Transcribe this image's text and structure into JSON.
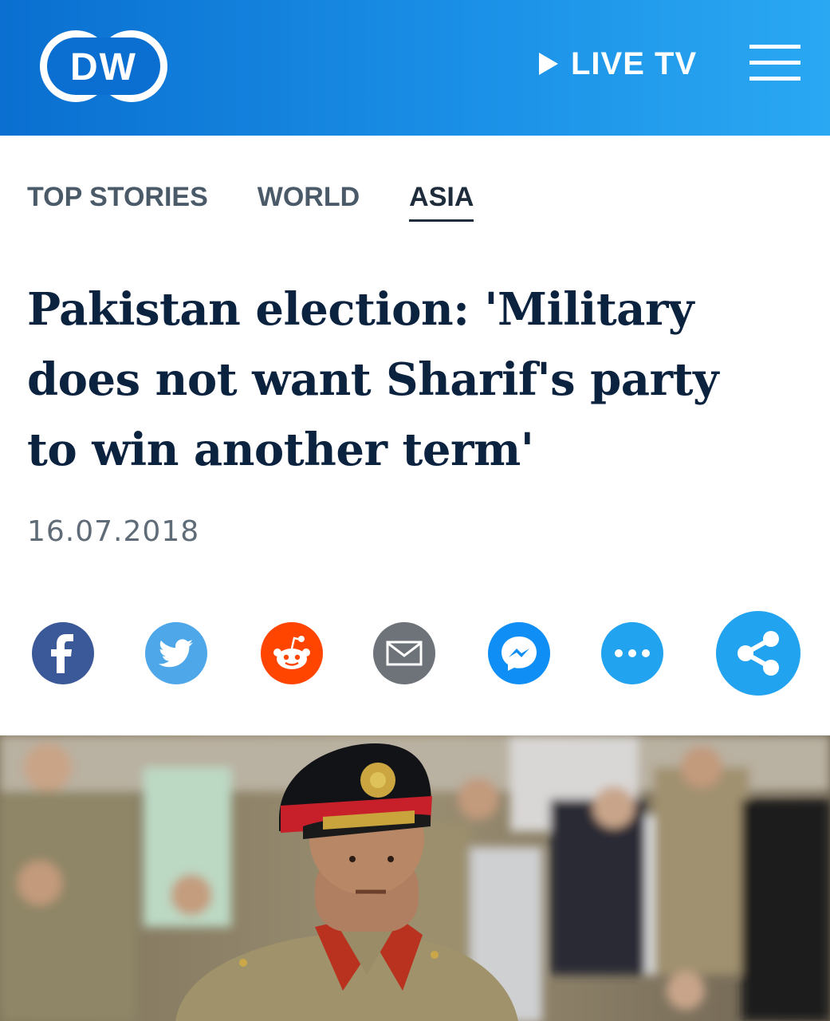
{
  "header": {
    "logo_text": "DW",
    "live_tv_label": "LIVE TV",
    "colors": {
      "header_start": "#0a6fd0",
      "header_end": "#2aa8f2"
    }
  },
  "nav": {
    "items": [
      {
        "label": "TOP STORIES",
        "active": false
      },
      {
        "label": "WORLD",
        "active": false
      },
      {
        "label": "ASIA",
        "active": true
      }
    ]
  },
  "article": {
    "title_lines": [
      "Pakistan election: 'Military",
      "does not want Sharif's party",
      "to win another term'"
    ],
    "date": "16.07.2018"
  },
  "share": {
    "buttons": [
      {
        "name": "facebook",
        "icon": "facebook-icon",
        "color": "#3b5998"
      },
      {
        "name": "twitter",
        "icon": "twitter-icon",
        "color": "#4da7e8"
      },
      {
        "name": "reddit",
        "icon": "reddit-icon",
        "color": "#ff4500"
      },
      {
        "name": "email",
        "icon": "mail-icon",
        "color": "#6d7378"
      },
      {
        "name": "messenger",
        "icon": "messenger-icon",
        "color": "#0f8ff5"
      },
      {
        "name": "more",
        "icon": "ellipsis-icon",
        "color": "#22a3f0"
      },
      {
        "name": "share",
        "icon": "share-icon",
        "color": "#22a3f0"
      }
    ]
  }
}
